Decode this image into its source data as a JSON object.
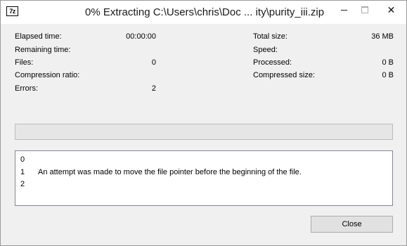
{
  "window": {
    "app_icon": "7z",
    "title": "0% Extracting C:\\Users\\chris\\Doc ... ity\\purity_iii.zip",
    "minimize_icon": "minimize-icon",
    "maximize_icon": "maximize-icon",
    "close_icon": "close-icon",
    "close_glyph": "✕"
  },
  "stats_left": [
    {
      "label": "Elapsed time:",
      "value": "00:00:00"
    },
    {
      "label": "Remaining time:",
      "value": ""
    },
    {
      "label": "Files:",
      "value": "0"
    },
    {
      "label": "Compression ratio:",
      "value": ""
    },
    {
      "label": "Errors:",
      "value": "2"
    }
  ],
  "stats_right": [
    {
      "label": "Total size:",
      "value": "36 MB"
    },
    {
      "label": "Speed:",
      "value": ""
    },
    {
      "label": "Processed:",
      "value": "0 B"
    },
    {
      "label": "Compressed size:",
      "value": "0 B"
    }
  ],
  "progress": {
    "fraction": 0,
    "fill_color": "#06b025"
  },
  "log": [
    {
      "index": "0",
      "message": ""
    },
    {
      "index": "1",
      "message": "An attempt was made to move the file pointer before the beginning of the file."
    },
    {
      "index": "2",
      "message": ""
    }
  ],
  "buttons": {
    "close_label": "Close"
  }
}
